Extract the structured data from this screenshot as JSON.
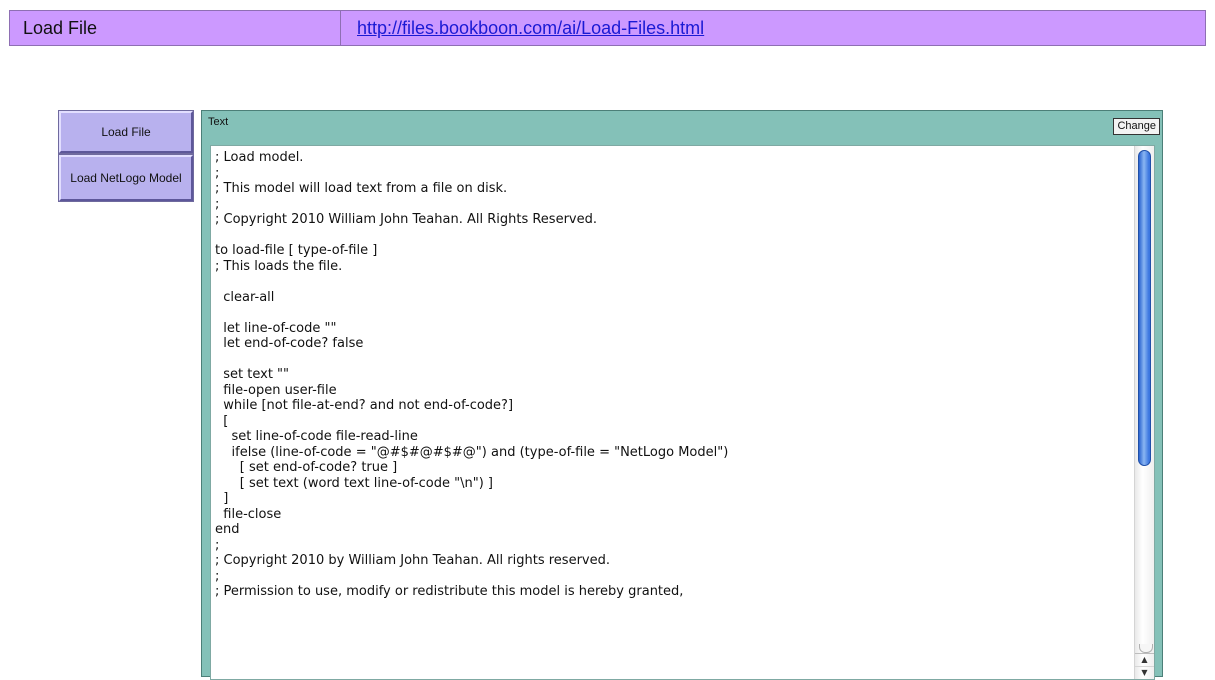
{
  "header": {
    "title": "Load File",
    "link": "http://files.bookboon.com/ai/Load-Files.html"
  },
  "buttons": {
    "load_file": "Load File",
    "load_netlogo_model": "Load NetLogo Model"
  },
  "text_widget": {
    "label": "Text",
    "change_label": "Change",
    "lines": [
      "; Load model.",
      ";",
      "; This model will load text from a file on disk.",
      ";",
      "; Copyright 2010 William John Teahan. All Rights Reserved.",
      "",
      "to load-file [ type-of-file ]",
      "; This loads the file.",
      "",
      "  clear-all",
      "",
      "  let line-of-code \"\"",
      "  let end-of-code? false",
      "",
      "  set text \"\"",
      "  file-open user-file",
      "  while [not file-at-end? and not end-of-code?]",
      "  [",
      "    set line-of-code file-read-line",
      "    ifelse (line-of-code = \"@#$#@#$#@\") and (type-of-file = \"NetLogo Model\")",
      "      [ set end-of-code? true ]",
      "      [ set text (word text line-of-code \"\\n\") ]",
      "  ]",
      "  file-close",
      "end",
      ";",
      "; Copyright 2010 by William John Teahan. All rights reserved.",
      ";",
      "; Permission to use, modify or redistribute this model is hereby granted,"
    ]
  },
  "scrollbar": {
    "up_arrow": "▲",
    "down_arrow": "▼"
  }
}
